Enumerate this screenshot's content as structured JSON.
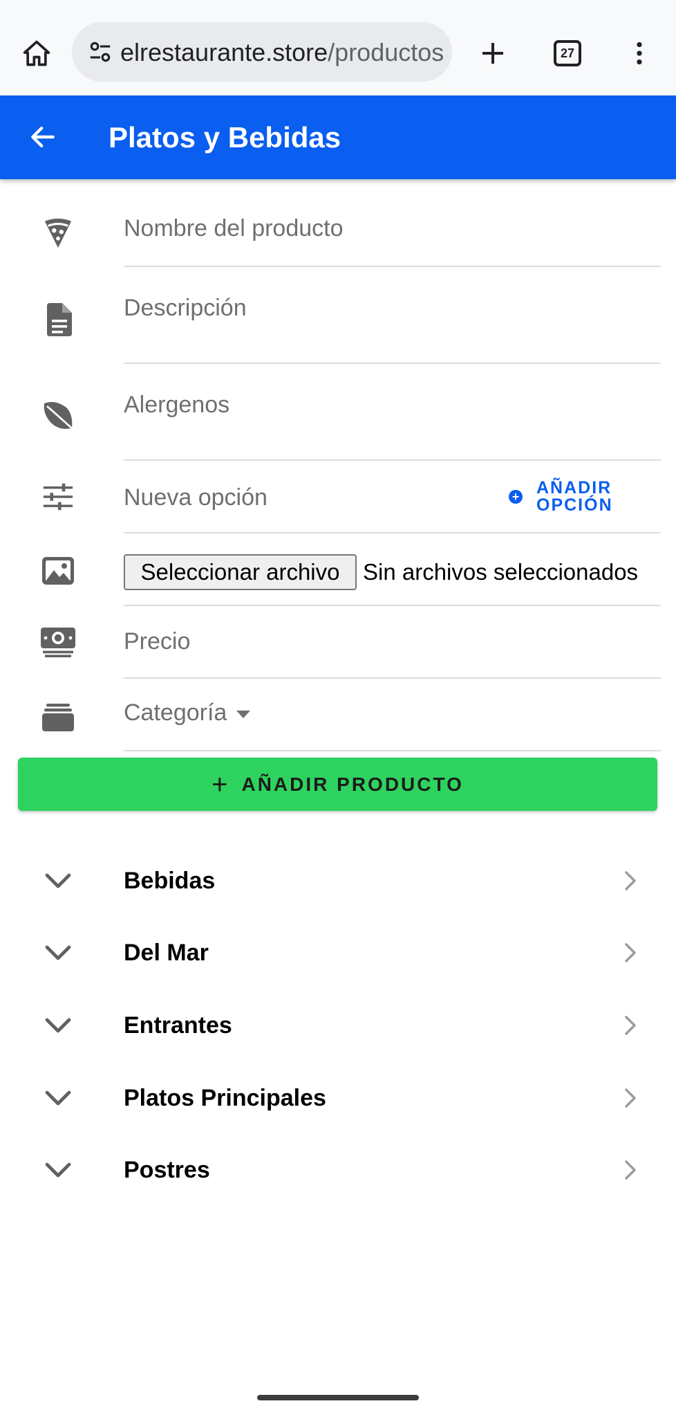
{
  "browser": {
    "url_host": "elrestaurante.store",
    "url_path": "/productos",
    "tab_count": "27",
    "icons": {
      "home": "home-icon",
      "site_info": "tune-icon",
      "new_tab": "plus-icon",
      "menu": "more-vert-icon"
    }
  },
  "app_bar": {
    "title": "Platos y Bebidas",
    "back_icon": "arrow-back-icon",
    "color": "#0a5ef0"
  },
  "form": {
    "name": {
      "placeholder": "Nombre del producto",
      "icon": "pizza-slice-icon"
    },
    "description": {
      "placeholder": "Descripción",
      "icon": "document-icon"
    },
    "allergens": {
      "placeholder": "Alergenos",
      "icon": "leaf-icon"
    },
    "option": {
      "placeholder": "Nueva opción",
      "icon": "sliders-icon",
      "add_label": "AÑADIR OPCIÓN"
    },
    "image": {
      "icon": "image-icon",
      "button_label": "Seleccionar archivo",
      "status": "Sin archivos seleccionados"
    },
    "price": {
      "placeholder": "Precio",
      "icon": "money-icon"
    },
    "category": {
      "placeholder": "Categoría",
      "icon": "layers-icon"
    },
    "submit_label": "AÑADIR PRODUCTO",
    "submit_color": "#2ed35f"
  },
  "categories": [
    {
      "label": "Bebidas"
    },
    {
      "label": "Del Mar"
    },
    {
      "label": "Entrantes"
    },
    {
      "label": "Platos Principales"
    },
    {
      "label": "Postres"
    }
  ]
}
